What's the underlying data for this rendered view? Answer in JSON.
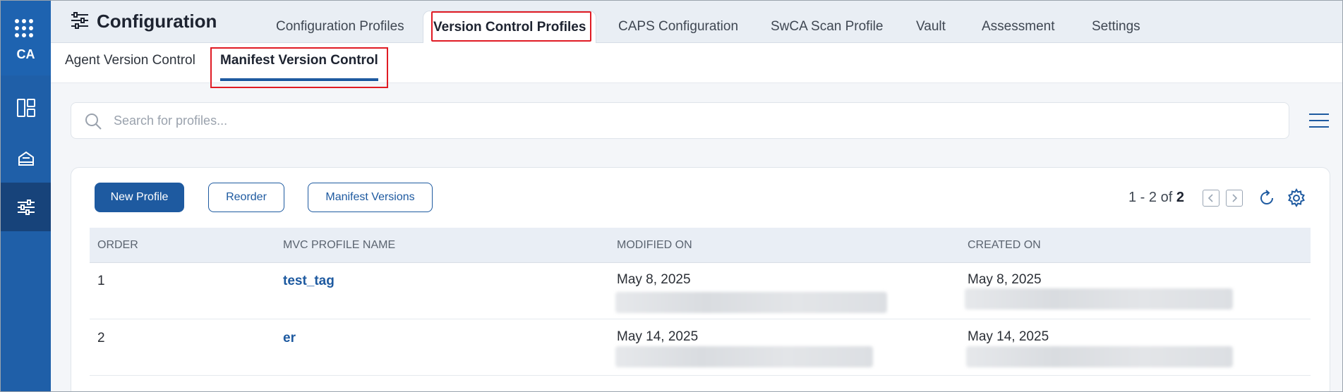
{
  "rail": {
    "brand": "CA"
  },
  "header": {
    "title": "Configuration",
    "tabs": [
      {
        "label": "Configuration Profiles"
      },
      {
        "label": "Version Control Profiles"
      },
      {
        "label": "CAPS Configuration"
      },
      {
        "label": "SwCA Scan Profile"
      },
      {
        "label": "Vault"
      },
      {
        "label": "Assessment"
      },
      {
        "label": "Settings"
      }
    ]
  },
  "subtabs": [
    {
      "label": "Agent Version Control"
    },
    {
      "label": "Manifest Version Control"
    }
  ],
  "search": {
    "placeholder": "Search for profiles..."
  },
  "toolbar": {
    "new_profile": "New Profile",
    "reorder": "Reorder",
    "manifest_versions": "Manifest Versions"
  },
  "pager": {
    "range": "1 - 2 of",
    "total": "2"
  },
  "table": {
    "columns": [
      "ORDER",
      "MVC PROFILE NAME",
      "MODIFIED ON",
      "CREATED ON"
    ],
    "rows": [
      {
        "order": "1",
        "name": "test_tag",
        "modified": "May 8, 2025",
        "created": "May 8, 2025"
      },
      {
        "order": "2",
        "name": "er",
        "modified": "May 14, 2025",
        "created": "May 14, 2025"
      }
    ]
  },
  "colors": {
    "accent": "#1e5aa0",
    "rail": "#1f5fa8",
    "highlight": "#e01b24"
  }
}
